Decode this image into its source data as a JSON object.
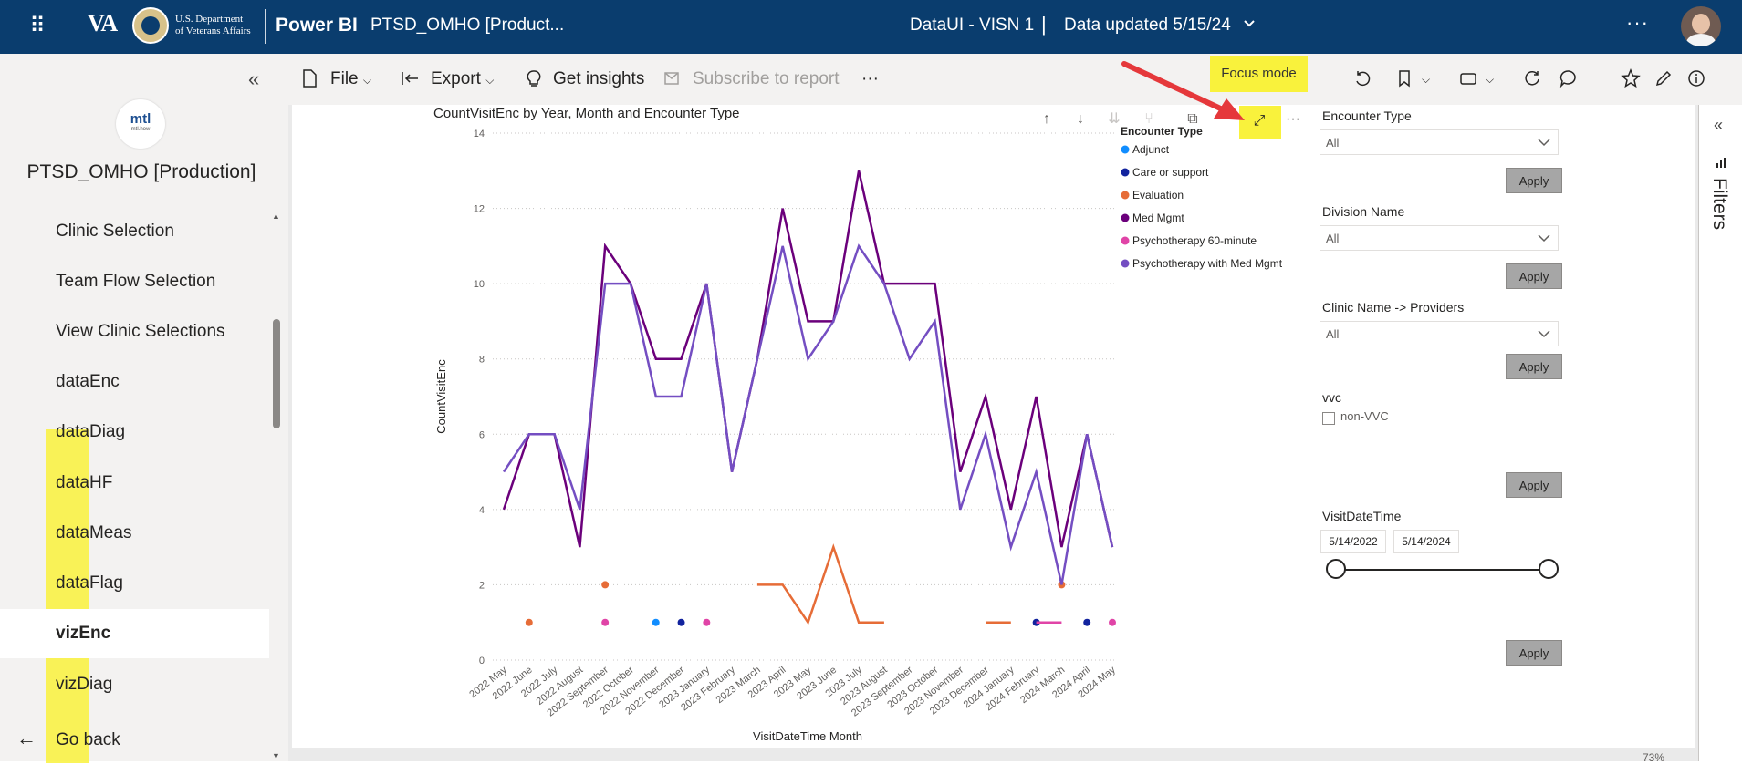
{
  "topbar": {
    "va_logo": "VA",
    "va_dept_line1": "U.S. Department",
    "va_dept_line2": "of Veterans Affairs",
    "product": "Power BI",
    "report_title": "PTSD_OMHO [Product...",
    "workspace": "DataUI - VISN 1",
    "separator": "|",
    "data_updated": "Data updated 5/15/24",
    "more": "···"
  },
  "sidebar": {
    "logo_text": "mtl",
    "logo_subtext": "mtl.how",
    "app_name": "PTSD_OMHO [Production]",
    "items": [
      {
        "label": "Clinic Selection"
      },
      {
        "label": "Team Flow Selection"
      },
      {
        "label": "View Clinic Selections"
      },
      {
        "label": "dataEnc"
      },
      {
        "label": "dataDiag"
      },
      {
        "label": "dataHF"
      },
      {
        "label": "dataMeas"
      },
      {
        "label": "dataFlag"
      },
      {
        "label": "vizEnc"
      },
      {
        "label": "vizDiag"
      }
    ],
    "go_back": "Go back"
  },
  "toolbar": {
    "file": "File",
    "export": "Export",
    "get_insights": "Get insights",
    "subscribe": "Subscribe to report",
    "more": "···",
    "focus_tooltip": "Focus mode"
  },
  "slicers": {
    "encounter_type": {
      "label": "Encounter Type",
      "value": "All",
      "apply": "Apply"
    },
    "division_name": {
      "label": "Division Name",
      "value": "All",
      "apply": "Apply"
    },
    "clinic_name": {
      "label": "Clinic Name -> Providers",
      "value": "All",
      "apply": "Apply"
    },
    "vvc": {
      "label": "vvc",
      "option": "non-VVC",
      "apply": "Apply"
    },
    "visit_date": {
      "label": "VisitDateTime",
      "start": "5/14/2022",
      "end": "5/14/2024",
      "apply": "Apply"
    }
  },
  "filters_pane": {
    "label": "Filters"
  },
  "status": {
    "zoom": "73%"
  },
  "chart_data": {
    "type": "line",
    "title": "CountVisitEnc by Year, Month and Encounter Type",
    "xlabel": "VisitDateTime Month",
    "ylabel": "CountVisitEnc",
    "ylim": [
      0,
      14
    ],
    "yticks": [
      0,
      2,
      4,
      6,
      8,
      10,
      12,
      14
    ],
    "grid": true,
    "legend_title": "Encounter Type",
    "legend_position": "top-right",
    "categories": [
      "2022 May",
      "2022 June",
      "2022 July",
      "2022 August",
      "2022 September",
      "2022 October",
      "2022 November",
      "2022 December",
      "2023 January",
      "2023 February",
      "2023 March",
      "2023 April",
      "2023 May",
      "2023 June",
      "2023 July",
      "2023 August",
      "2023 September",
      "2023 October",
      "2023 November",
      "2023 December",
      "2024 January",
      "2024 February",
      "2024 March",
      "2024 April",
      "2024 May"
    ],
    "series": [
      {
        "name": "Adjunct",
        "color": "#118dff",
        "values": [
          null,
          null,
          null,
          null,
          null,
          null,
          1,
          null,
          null,
          null,
          null,
          null,
          null,
          null,
          null,
          null,
          null,
          null,
          null,
          null,
          null,
          null,
          null,
          null,
          null
        ]
      },
      {
        "name": "Care or support",
        "color": "#12239e",
        "values": [
          null,
          null,
          null,
          null,
          null,
          null,
          null,
          1,
          null,
          null,
          null,
          null,
          null,
          null,
          null,
          null,
          null,
          null,
          null,
          null,
          null,
          1,
          null,
          1,
          null
        ]
      },
      {
        "name": "Evaluation",
        "color": "#e66c37",
        "values": [
          null,
          1,
          null,
          null,
          2,
          null,
          null,
          null,
          null,
          null,
          2,
          2,
          1,
          3,
          1,
          1,
          null,
          null,
          null,
          1,
          1,
          null,
          2,
          null,
          null
        ]
      },
      {
        "name": "Med Mgmt",
        "color": "#6b007b",
        "values": [
          4,
          6,
          6,
          3,
          11,
          10,
          8,
          8,
          10,
          5,
          8,
          12,
          9,
          9,
          13,
          10,
          10,
          10,
          5,
          7,
          4,
          7,
          3,
          6,
          3
        ]
      },
      {
        "name": "Psychotherapy 60-minute",
        "color": "#e044a7",
        "values": [
          null,
          null,
          null,
          null,
          1,
          null,
          null,
          null,
          1,
          null,
          null,
          null,
          null,
          null,
          null,
          null,
          null,
          null,
          null,
          null,
          null,
          1,
          1,
          null,
          1
        ]
      },
      {
        "name": "Psychotherapy with Med Mgmt",
        "color": "#744ec2",
        "values": [
          5,
          6,
          6,
          4,
          10,
          10,
          7,
          7,
          10,
          5,
          8,
          11,
          8,
          9,
          11,
          10,
          8,
          9,
          4,
          6,
          3,
          5,
          2,
          6,
          3
        ]
      }
    ]
  }
}
